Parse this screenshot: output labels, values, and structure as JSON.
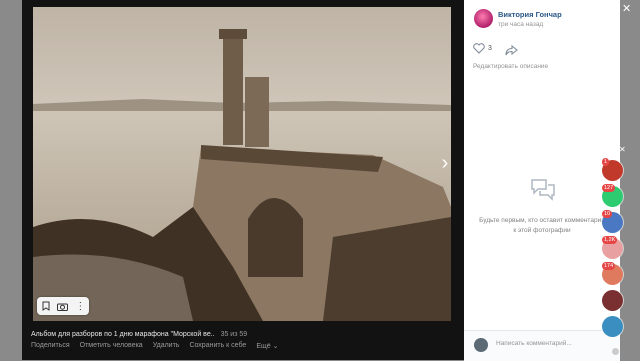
{
  "post": {
    "author": "Виктория Гончар",
    "time": "три часа назад",
    "likes": "3",
    "edit_label": "Редактировать описание"
  },
  "comments": {
    "empty_text": "Будьте первым, кто оставит комментарий к этой фотографии",
    "input_placeholder": "Написать комментарий..."
  },
  "photo": {
    "album": "Альбом для разборов по 1 дню марафона \"Морской ве..",
    "counter": "35 из 59",
    "actions": [
      "Поделиться",
      "Отметить человека",
      "Удалить",
      "Сохранить к себе",
      "Ещё ⌄"
    ]
  },
  "side_chats": [
    {
      "badge": "1",
      "color": "#c0392b"
    },
    {
      "badge": "127",
      "color": "#2ecc71"
    },
    {
      "badge": "10",
      "color": "#4a78c2"
    },
    {
      "badge": "1,2K",
      "color": "#e8a0a0"
    },
    {
      "badge": "174",
      "color": "#e07a5f"
    },
    {
      "badge": "",
      "color": "#7a3030"
    },
    {
      "badge": "",
      "color": "#3a8fc0"
    }
  ],
  "colors": {
    "link": "#2a5885",
    "muted": "#939393",
    "badge": "#e64646"
  }
}
